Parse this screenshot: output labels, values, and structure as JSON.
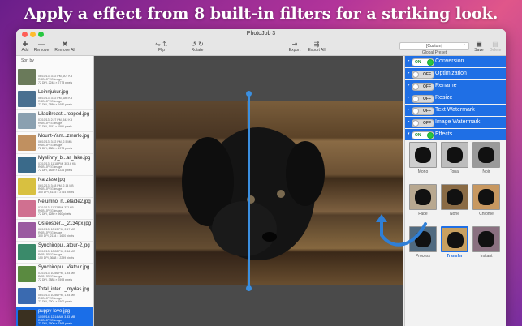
{
  "headline": "Apply a effect from 8 built-in filters for a striking look.",
  "window": {
    "title": "PhotoJob 3"
  },
  "toolbar": {
    "add": "Add",
    "remove": "Remove",
    "remove_all": "Remove All",
    "flip": "Flip",
    "rotate": "Rotate",
    "export": "Export",
    "export_all": "Export All",
    "preset_value": "[Custom]",
    "preset_label": "Global Preset",
    "save": "Save",
    "delete": "Delete"
  },
  "sidebar": {
    "sort_label": "Sort by",
    "files": [
      {
        "name": "",
        "meta": "06/10/13, 3:22 PM, 607 KB\nRGB, JPEG image\n72 DPI, 2248 × 2778 pixels",
        "color": "#6a7a5a"
      },
      {
        "name": "Leihnjukur.jpg",
        "meta": "06/10/13, 3:22 PM, 686 KB\nRGB, JPEG image\n72 DPI, 2880 × 1680 pixels",
        "color": "#4a7090"
      },
      {
        "name": "LilacBreast...ropped.jpg",
        "meta": "07/10/13, 2:27 PM, 542 KB\nRGB, JPEG image\n72 DPI, 1152 × 1596 pixels",
        "color": "#8aa0b0"
      },
      {
        "name": "Mount-Yam...zmurlo.jpg",
        "meta": "06/10/13, 3:22 PM, 2.5 MB\nRGB, JPEG image\n72 DPI, 2880 × 1973 pixels",
        "color": "#c09060"
      },
      {
        "name": "Myslinny_b...ar_lake.jpg",
        "meta": "07/10/13, 11:18 PM, 303.6 KB\nRGB, JPEG image\n72 DPI, 1830 × 1226 pixels",
        "color": "#3a6a8a"
      },
      {
        "name": "Narzisse.jpg",
        "meta": "06/12/13, 3:48 PM, 2.14 MB\nRGB, JPEG image\n300 DPI, 4145 × 2764 pixels",
        "color": "#d8c040"
      },
      {
        "name": "Nelumno_n...elaide2.jpg",
        "meta": "07/10/13, 11:22 PM, 332 KB\nRGB, JPEG image\n72 DPI, 1280 × 960 pixels",
        "color": "#d07090"
      },
      {
        "name": "Osteosper..._2134px.jpg",
        "meta": "06/10/13, 10:13 PM, 2.47 MB\nRGB, JPEG image\n300 DPI, 2134 × 1600 pixels",
        "color": "#9a5aa0"
      },
      {
        "name": "Synchiropu...atour-2.jpg",
        "meta": "07/10/13, 10:28 PM, 2.66 MB\nRGB, JPEG image\n150 DPI, 3688 × 2299 pixels",
        "color": "#3a8a6a"
      },
      {
        "name": "Synchiropu...Viatour.jpg",
        "meta": "07/10/13, 10:56 PM, 1.84 MB\nRGB, JPEG image\n72 DPI, 3888 × 2593 pixels",
        "color": "#5a8a40"
      },
      {
        "name": "Total_inter..._mydas.jpg",
        "meta": "06/10/13, 10:56 PM, 1.84 MB\nRGB, JPEG image\n72 DPI, 2304 × 1500 pixels",
        "color": "#3a6ab0"
      },
      {
        "name": "puppy-love.jpg",
        "meta": "10/09/14, 12:14 AM, 3.83 MB\nRGB, JPEG image\n72 DPI, 3600 × 2368 pixels",
        "color": "#3a3020"
      }
    ]
  },
  "panel": {
    "sections": [
      {
        "label": "Conversion",
        "toggle": "ON",
        "on": true,
        "disc": "▸"
      },
      {
        "label": "Optimization",
        "toggle": "OFF",
        "on": false,
        "disc": "▸"
      },
      {
        "label": "Rename",
        "toggle": "OFF",
        "on": false,
        "disc": "▸"
      },
      {
        "label": "Resize",
        "toggle": "OFF",
        "on": false,
        "disc": "▸"
      },
      {
        "label": "Text Watermark",
        "toggle": "OFF",
        "on": false,
        "disc": "▸"
      },
      {
        "label": "Image Watermark",
        "toggle": "OFF",
        "on": false,
        "disc": "▸"
      },
      {
        "label": "Effects",
        "toggle": "ON",
        "on": true,
        "disc": "▾"
      }
    ],
    "effects": [
      {
        "label": "Mono",
        "bg": "#cfcfcf",
        "selected": false
      },
      {
        "label": "Tonal",
        "bg": "#bdbdbd",
        "selected": false
      },
      {
        "label": "Noir",
        "bg": "#9a9a9a",
        "selected": false
      },
      {
        "label": "Fade",
        "bg": "#b8a890",
        "selected": false
      },
      {
        "label": "None",
        "bg": "#8a6b45",
        "selected": false
      },
      {
        "label": "Chrome",
        "bg": "#c89860",
        "selected": false
      },
      {
        "label": "Process",
        "bg": "#506a80",
        "selected": false
      },
      {
        "label": "Transfer",
        "bg": "#c8a060",
        "selected": true
      },
      {
        "label": "Instant",
        "bg": "#8a7080",
        "selected": false
      }
    ]
  },
  "colors": {
    "accent": "#1f6fe5",
    "split": "#3b8fe0",
    "toggle_on": "#28c840"
  }
}
